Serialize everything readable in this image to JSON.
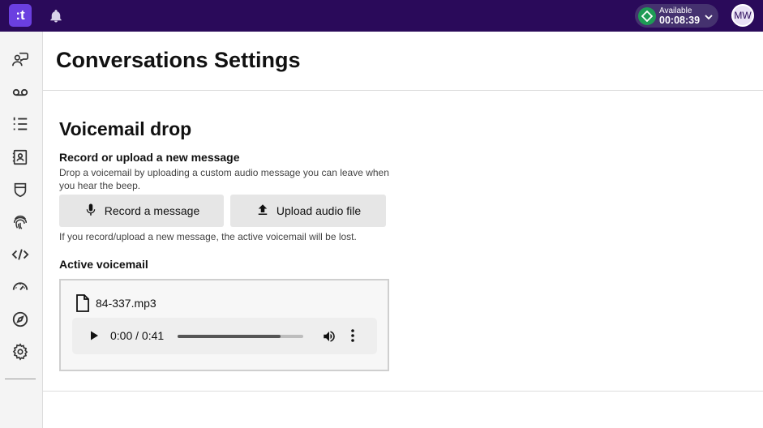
{
  "topbar": {
    "logo_text": ":t",
    "status_label": "Available",
    "status_timer": "00:08:39",
    "avatar_initials": "MW"
  },
  "sidebar": {
    "items": [
      {
        "icon": "conversations-icon"
      },
      {
        "icon": "voicemail-icon"
      },
      {
        "icon": "list-icon"
      },
      {
        "icon": "contacts-icon"
      },
      {
        "icon": "shield-icon"
      },
      {
        "icon": "fingerprint-icon"
      },
      {
        "icon": "code-icon"
      },
      {
        "icon": "gauge-icon"
      },
      {
        "icon": "compass-icon"
      },
      {
        "icon": "gear-icon"
      }
    ]
  },
  "main": {
    "page_title": "Conversations Settings",
    "section_title": "Voicemail drop",
    "record_title": "Record or upload a new message",
    "record_description": "Drop a voicemail by uploading a custom audio message you can leave when you hear the beep.",
    "record_button_label": "Record a message",
    "upload_button_label": "Upload audio file",
    "warning_text": "If you record/upload a new message, the active voicemail will be lost.",
    "active_title": "Active voicemail",
    "active_file_name": "84-337.mp3",
    "player": {
      "time_display": "0:00 / 0:41",
      "progress_percent": 82
    }
  },
  "colors": {
    "topbar": "#2a0a5a",
    "logo": "#6b3fe0",
    "status_green": "#1e9c55"
  }
}
